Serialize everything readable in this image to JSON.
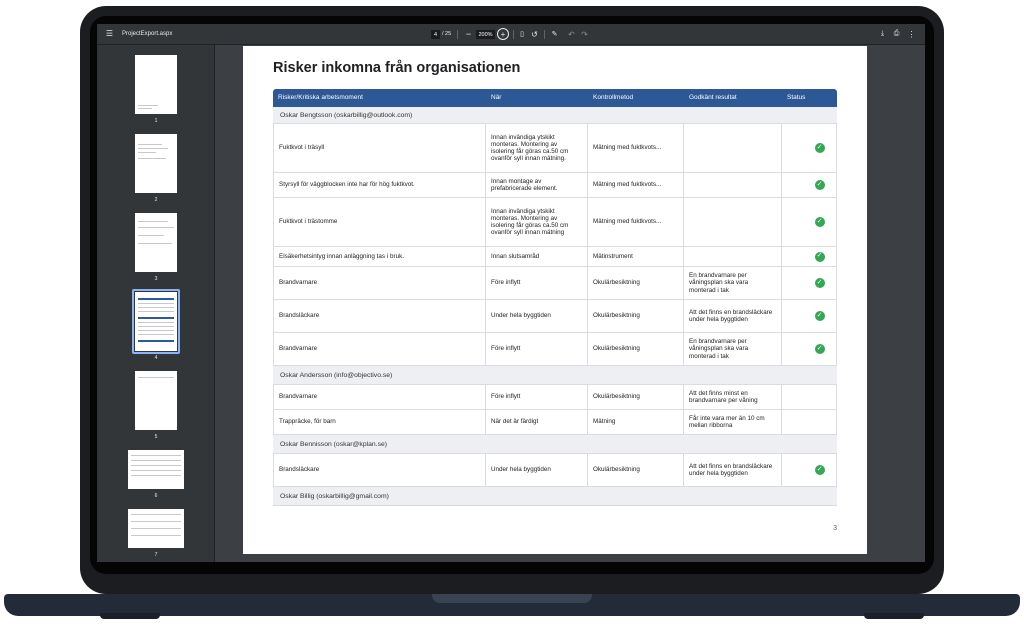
{
  "toolbar": {
    "file_name": "ProjectExport.aspx",
    "current_page": "4",
    "total_pages": "/ 25",
    "zoom": "200%",
    "icons": [
      "menu-icon",
      "zoom-out-icon",
      "zoom-in-icon",
      "fit-page-icon",
      "rotate-icon",
      "annotate-icon",
      "undo-icon",
      "redo-icon",
      "download-icon",
      "print-icon",
      "more-icon"
    ]
  },
  "sidebar": {
    "thumbnails": [
      {
        "label": "1"
      },
      {
        "label": "2"
      },
      {
        "label": "3"
      },
      {
        "label": "4",
        "selected": true
      },
      {
        "label": "5"
      },
      {
        "label": "6"
      },
      {
        "label": "7"
      }
    ]
  },
  "document": {
    "title": "Risker inkomna från organisationen",
    "page_number": "3",
    "columns": [
      "Risker/Kritiska arbetsmoment",
      "När",
      "Kontrollmetod",
      "Godkänt resultat",
      "Status"
    ],
    "groups": [
      {
        "name": "Oskar Bengtsson (oskarbillig@outlook.com)",
        "rows": [
          {
            "risk": "Fuktkvot i träsyll",
            "when": "Innan invändiga ytskikt monteras. Montering av isolering får göras ca.50 cm ovanför syll innan mätning.",
            "method": "Mätning med fuktkvots...",
            "result": "",
            "status": "approved"
          },
          {
            "risk": "Styrsyll för väggblocken inte har för hög fuktkvot.",
            "when": "Innan montage av prefabricerade element.",
            "method": "Mätning med fuktkvots...",
            "result": "",
            "status": "approved"
          },
          {
            "risk": "Fuktkvot i trästomme",
            "when": "Innan invändiga ytskikt monteras. Montering av isolering får göras ca.50 cm ovanför syll innan mätning",
            "method": "Mätning med fuktkvots...",
            "result": "",
            "status": "approved"
          },
          {
            "risk": "Elsäkerhetsintyg innan anläggning tas i bruk.",
            "when": "Innan slutsamråd",
            "method": "Mätinstrument",
            "result": "",
            "status": "approved"
          },
          {
            "risk": "Brandvarnare",
            "when": "Före inflytt",
            "method": "Okulärbesiktning",
            "result": "En brandvarnare per våningsplan ska vara monterad i tak",
            "status": "approved"
          },
          {
            "risk": "Brandsläckare",
            "when": "Under hela byggtiden",
            "method": "Okulärbesiktning",
            "result": "Att det finns en brandsläckare under hela byggtiden",
            "status": "approved"
          },
          {
            "risk": "Brandvarnare",
            "when": "Före inflytt",
            "method": "Okulärbesiktning",
            "result": "En brandvarnare per våningsplan ska vara monterad i tak",
            "status": "approved"
          }
        ]
      },
      {
        "name": "Oskar Andersson (info@objectivo.se)",
        "rows": [
          {
            "risk": "Brandvarnare",
            "when": "Före inflytt",
            "method": "Okulärbesiktning",
            "result": "Att det finns minst en brandvarnare per våning",
            "status": ""
          },
          {
            "risk": "Trappräcke, för barn",
            "when": "När det är färdigt",
            "method": "Mätning",
            "result": "Får inte vara mer än 10 cm mellan ribborna",
            "status": ""
          }
        ]
      },
      {
        "name": "Oskar Bennisson (oskar@kplan.se)",
        "rows": [
          {
            "risk": "Brandsläckare",
            "when": "Under hela byggtiden",
            "method": "Okulärbesiktning",
            "result": "Att det finns en brandsläckare under hela byggtiden",
            "status": "approved"
          }
        ]
      },
      {
        "name": "Oskar Billig (oskarbillig@gmail.com)",
        "rows": []
      }
    ]
  },
  "colors": {
    "header": "#2d5795",
    "status_ok": "#34a853",
    "viewer_bg": "#323639"
  }
}
